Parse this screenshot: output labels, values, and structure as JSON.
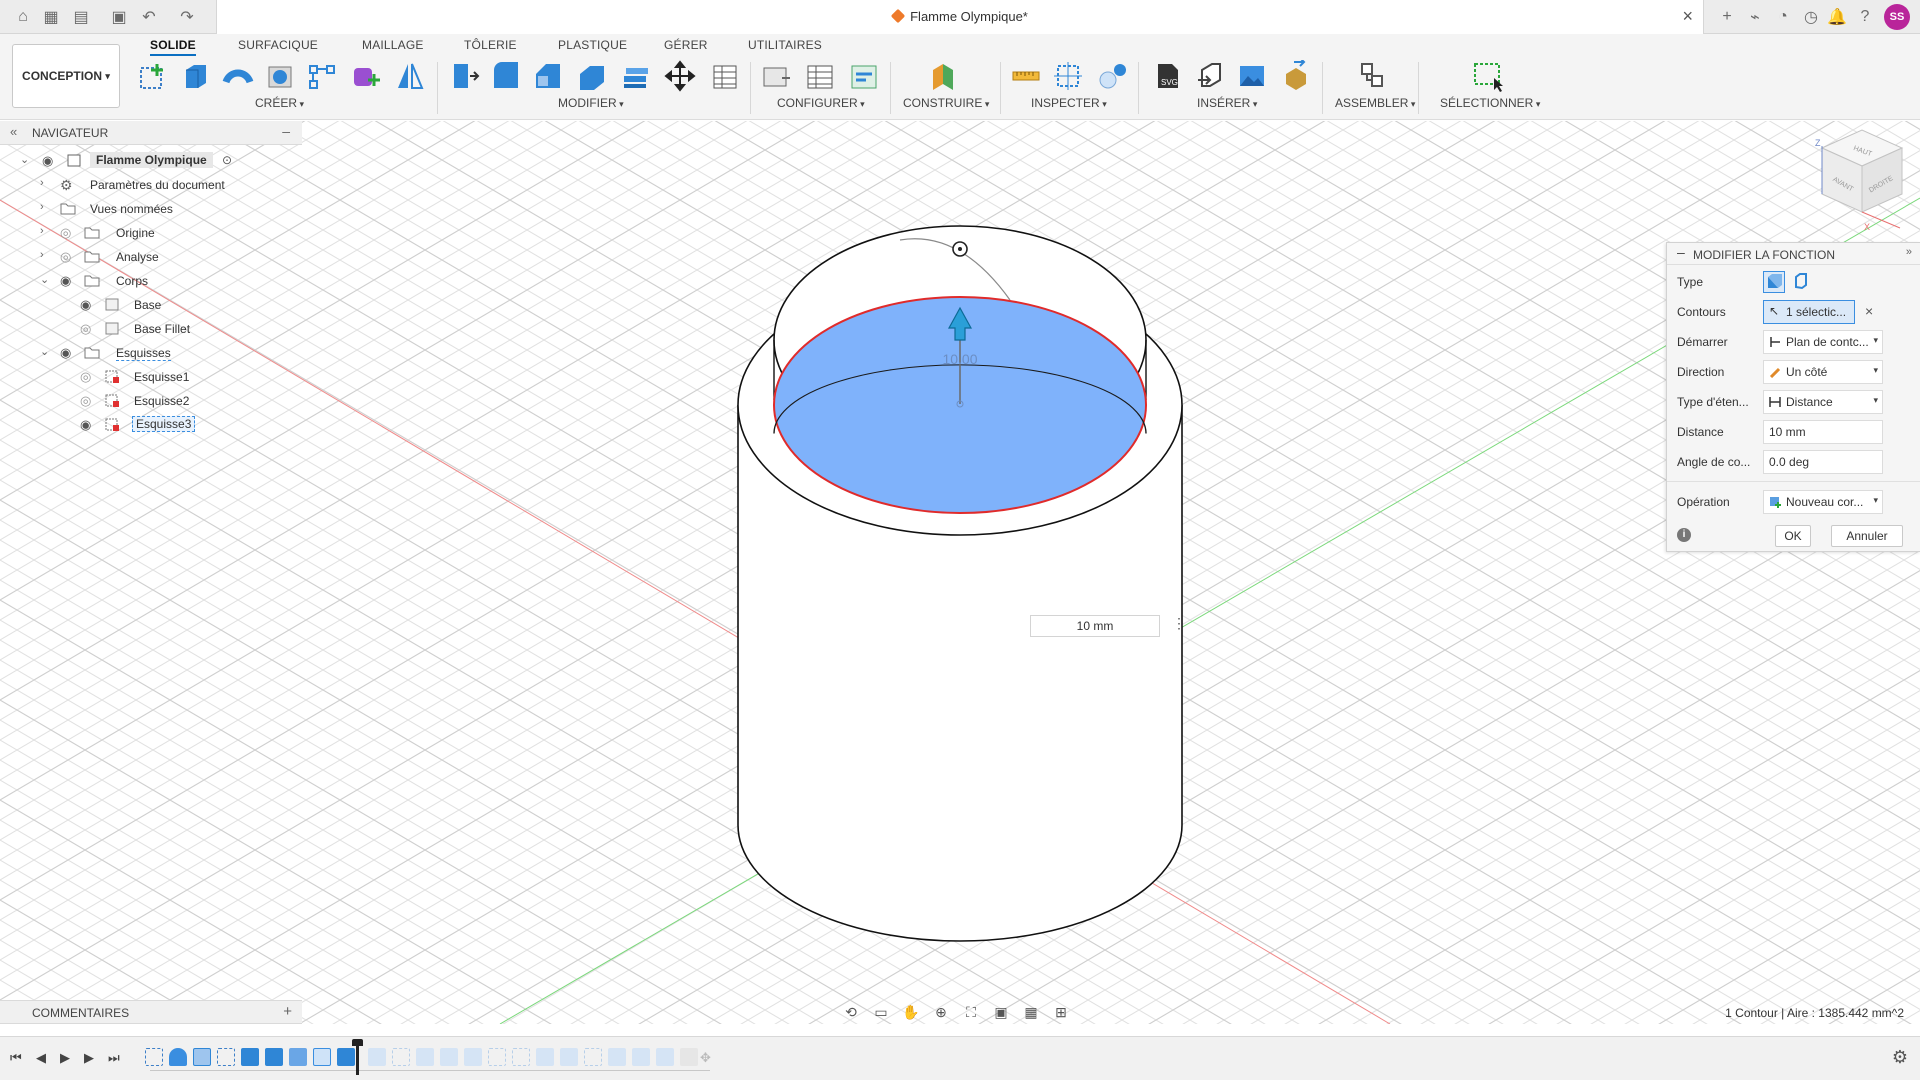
{
  "title_bar": {
    "doc_title": "Flamme Olympique*",
    "user_initials": "SS"
  },
  "toolbar": {
    "workspace": "CONCEPTION",
    "tabs": [
      "SOLIDE",
      "SURFACIQUE",
      "MAILLAGE",
      "TÔLERIE",
      "PLASTIQUE",
      "GÉRER",
      "UTILITAIRES"
    ],
    "active_tab": "SOLIDE",
    "groups": [
      "CRÉER",
      "MODIFIER",
      "CONFIGURER",
      "CONSTRUIRE",
      "INSPECTER",
      "INSÉRER",
      "ASSEMBLER",
      "SÉLECTIONNER"
    ]
  },
  "navigator": {
    "title": "NAVIGATEUR",
    "items": [
      {
        "label": "Flamme Olympique"
      },
      {
        "label": "Paramètres du document"
      },
      {
        "label": "Vues nommées"
      },
      {
        "label": "Origine"
      },
      {
        "label": "Analyse"
      },
      {
        "label": "Corps"
      },
      {
        "label": "Base"
      },
      {
        "label": "Base Fillet"
      },
      {
        "label": "Esquisses"
      },
      {
        "label": "Esquisse1"
      },
      {
        "label": "Esquisse2"
      },
      {
        "label": "Esquisse3"
      }
    ]
  },
  "viewport": {
    "dimension_label": "10.00",
    "distance_input": "10 mm",
    "viewcube": {
      "top": "HAUT",
      "front": "AVANT",
      "right": "DROITE"
    }
  },
  "feature_panel": {
    "title": "MODIFIER LA FONCTION",
    "rows": {
      "type": {
        "label": "Type"
      },
      "contours": {
        "label": "Contours",
        "value": "1 sélectic..."
      },
      "start": {
        "label": "Démarrer",
        "value": "Plan de contc..."
      },
      "direction": {
        "label": "Direction",
        "value": "Un côté"
      },
      "extent": {
        "label": "Type d'éten...",
        "value": "Distance"
      },
      "distance": {
        "label": "Distance",
        "value": "10 mm"
      },
      "angle": {
        "label": "Angle de co...",
        "value": "0.0 deg"
      },
      "operation": {
        "label": "Opération",
        "value": "Nouveau cor..."
      }
    },
    "ok": "OK",
    "cancel": "Annuler"
  },
  "comments": {
    "title": "COMMENTAIRES"
  },
  "status": {
    "text": "1 Contour | Aire : 1385.442 mm^2"
  },
  "colors": {
    "selection_fill": "#7fb2fb",
    "selection_outline": "#e02b2b",
    "accent": "#0a6fc2",
    "x_axis": "#f07070",
    "y_axis": "#6cd46c"
  }
}
